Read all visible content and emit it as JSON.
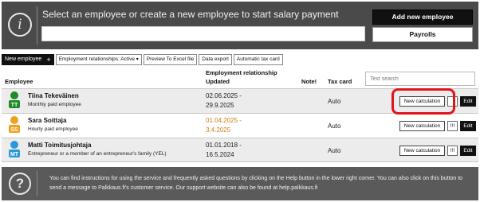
{
  "banner": {
    "prompt": "Select an employee or create a new employee to start salary payment",
    "add_new_employee_label": "Add new employee",
    "payrolls_label": "Payrolls",
    "info_glyph": "i"
  },
  "toolbar": {
    "new_employee_label": "New employee",
    "plus_glyph": "+",
    "filter_label": "Employment relationships: Active",
    "filter_caret": "▾",
    "preview_excel_label": "Preview To Excel file",
    "data_export_label": "Data export",
    "automatic_tax_card_label": "Automatic tax card"
  },
  "table": {
    "header": {
      "employee": "Employee",
      "relationship_line1": "Employment relationship",
      "relationship_line2": "Updated",
      "note": "Note!",
      "tax_card": "Tax card"
    },
    "search_placeholder": "Text search",
    "rows": [
      {
        "name": "Tiina Tekeväinen",
        "type": "Monthly paid employee",
        "start": "02.06.2025 -",
        "end": "29.9.2025",
        "tax_card": "Auto",
        "calc_label": "New calculation",
        "warn_label": "",
        "edit_label": "Edit",
        "avatar_icon": "monthly-employee-icon",
        "avatar_text": "TT",
        "date_color": "#222222"
      },
      {
        "name": "Sara Soittaja",
        "type": "Hourly paid employee",
        "start": "01.04.2025 -",
        "end": "3.4.2025",
        "tax_card": "Auto",
        "calc_label": "New calculation",
        "warn_label": "!!!",
        "edit_label": "Edit",
        "avatar_icon": "hourly-employee-icon",
        "avatar_text": "SS",
        "date_color": "#d07a12"
      },
      {
        "name": "Matti Toimitusjohtaja",
        "type": "Entrepreneur or a member of an entrepreneur's family (YEL)",
        "start": "01.01.2018 -",
        "end": "16.5.2024",
        "tax_card": "Auto",
        "calc_label": "New calculation",
        "warn_label": "!!!",
        "edit_label": "Edit",
        "avatar_icon": "entrepreneur-icon",
        "avatar_text": "MT",
        "date_color": "#222222"
      }
    ]
  },
  "footer": {
    "help_glyph": "?",
    "text": "You can find instructions for using the service and frequently asked questions by clicking on the Help button in the lower right corner. You can also click on this button to send a message to Palkkaus.fi's customer service. Our support website can also be found at help.palkkaus.fi"
  },
  "colors": {
    "banner_bg": "#4a4a4a",
    "footer_bg": "#5a5a5a",
    "highlight": "#e0151c",
    "green_avatar": "#1e8a2a",
    "orange_avatar": "#f0a020",
    "blue_avatar": "#2a9ad6"
  }
}
